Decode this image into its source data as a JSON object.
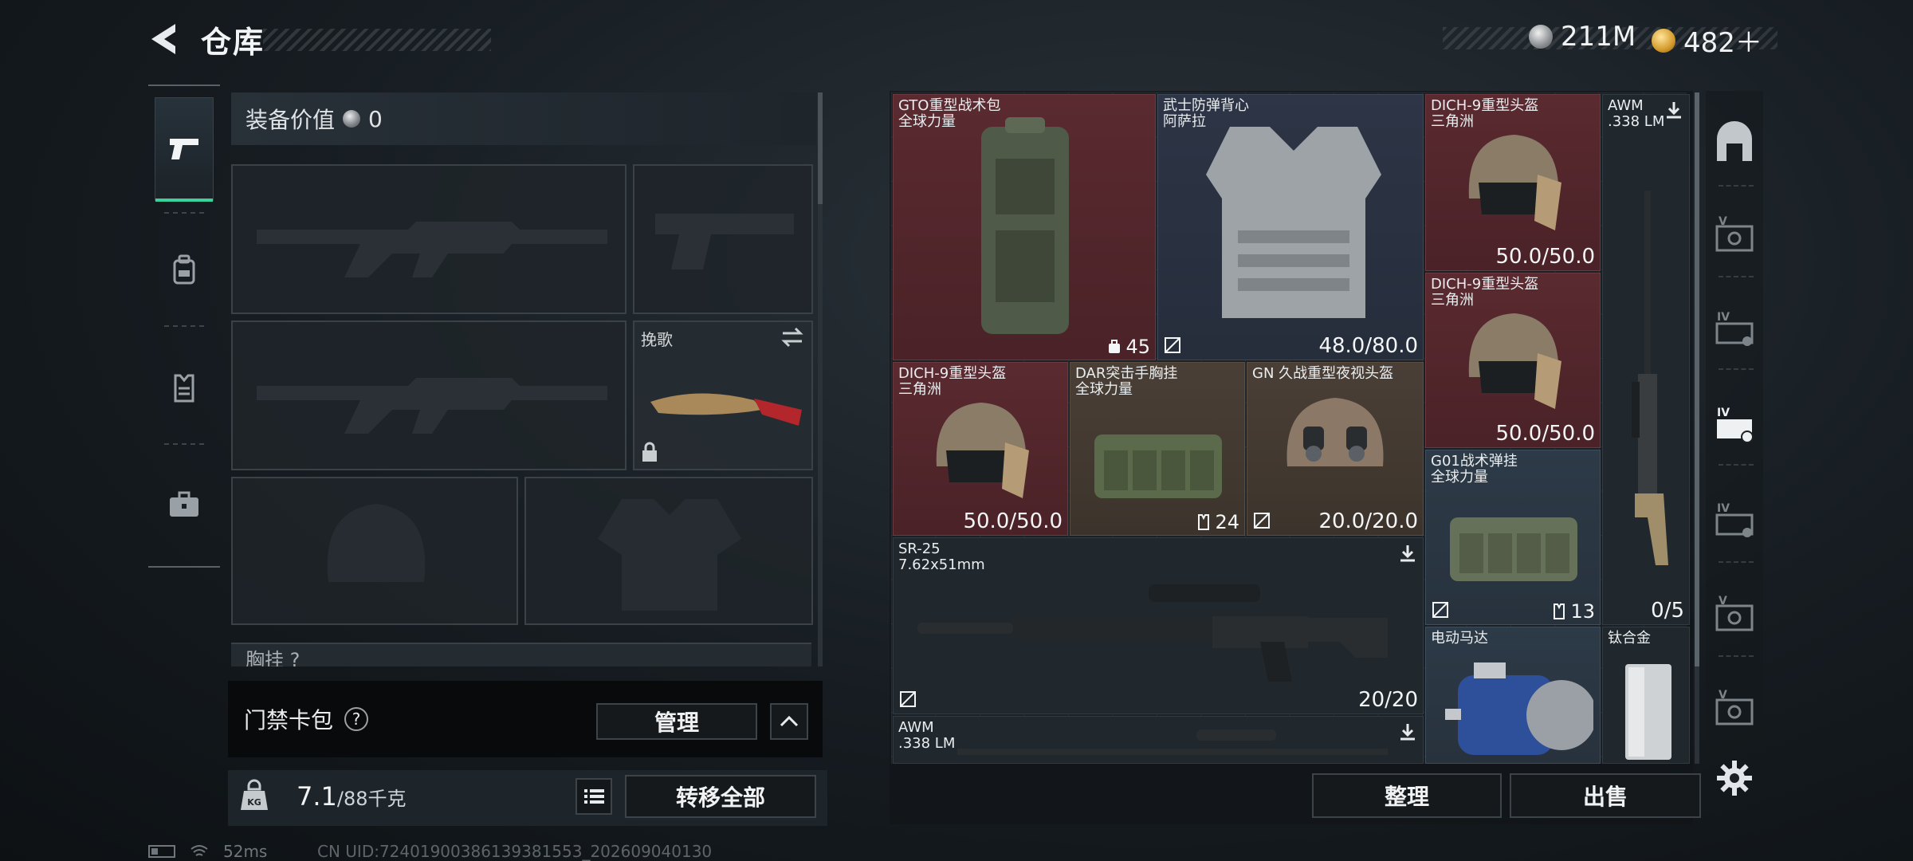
{
  "header": {
    "title": "仓库",
    "back_icon": "back-arrow-icon",
    "currency": [
      {
        "icon": "silver-coin-icon",
        "value": "211M"
      },
      {
        "icon": "gold-coin-icon",
        "value": "482＋"
      }
    ]
  },
  "left_rail": {
    "tabs": [
      {
        "icon": "pistol-icon",
        "active": true
      },
      {
        "icon": "backpack-icon",
        "active": false
      },
      {
        "icon": "vest-icon",
        "active": false
      },
      {
        "icon": "briefcase-icon",
        "active": false
      }
    ]
  },
  "loadout": {
    "equip_value_label": "装备价值",
    "equip_value": "0",
    "melee_label": "挽歌",
    "chest_label_partial": "胸挂 ?"
  },
  "keycard": {
    "label": "门禁卡包",
    "help": "?",
    "manage_label": "管理"
  },
  "weight": {
    "current": "7.1",
    "max": "/88千克",
    "transfer_all_label": "转移全部"
  },
  "stash": {
    "items": [
      {
        "name": "GTO重型战术包",
        "sub": "全球力量",
        "count": "45"
      },
      {
        "name": "武士防弹背心",
        "sub": "阿萨拉",
        "durability": "48.0/80.0"
      },
      {
        "name": "DICH-9重型头盔",
        "sub": "三角洲",
        "durability": "50.0/50.0"
      },
      {
        "name": "AWM",
        "sub": ".338 LM"
      },
      {
        "name": "DICH-9重型头盔",
        "sub": "三角洲",
        "durability": "50.0/50.0"
      },
      {
        "name": "DICH-9重型头盔",
        "sub": "三角洲",
        "durability": "50.0/50.0"
      },
      {
        "name": "DAR突击手胸挂",
        "sub": "全球力量",
        "count": "24"
      },
      {
        "name": "GN 久战重型夜视头盔",
        "sub": "",
        "durability": "20.0/20.0"
      },
      {
        "name": "G01战术弹挂",
        "sub": "全球力量",
        "count": "13"
      },
      {
        "name": "",
        "sub": "",
        "ammo": "0/5"
      },
      {
        "name": "SR-25",
        "sub": "7.62x51mm",
        "ammo": "20/20"
      },
      {
        "name": "电动马达",
        "sub": ""
      },
      {
        "name": "钛合金",
        "sub": ""
      },
      {
        "name": "AWM",
        "sub": ".338 LM"
      }
    ],
    "sort_label": "整理",
    "sell_label": "出售"
  },
  "right_rail": {
    "items": [
      "safehouse-icon",
      "tier-v-case-icon",
      "tier-iv-case-icon",
      "tier-iv-case-active-icon",
      "tier-iv-case-icon",
      "tier-v-case-icon",
      "tier-v-case-icon"
    ],
    "settings_icon": "gear-icon"
  },
  "status": {
    "ping": "52ms",
    "uid": "CN UID:7240190038613938155​3_202609040130"
  },
  "colors": {
    "accent": "#3ad29a",
    "rarity_red": "#5a2a30",
    "rarity_blue": "#2d3546",
    "rarity_brown": "#4a3f36"
  }
}
